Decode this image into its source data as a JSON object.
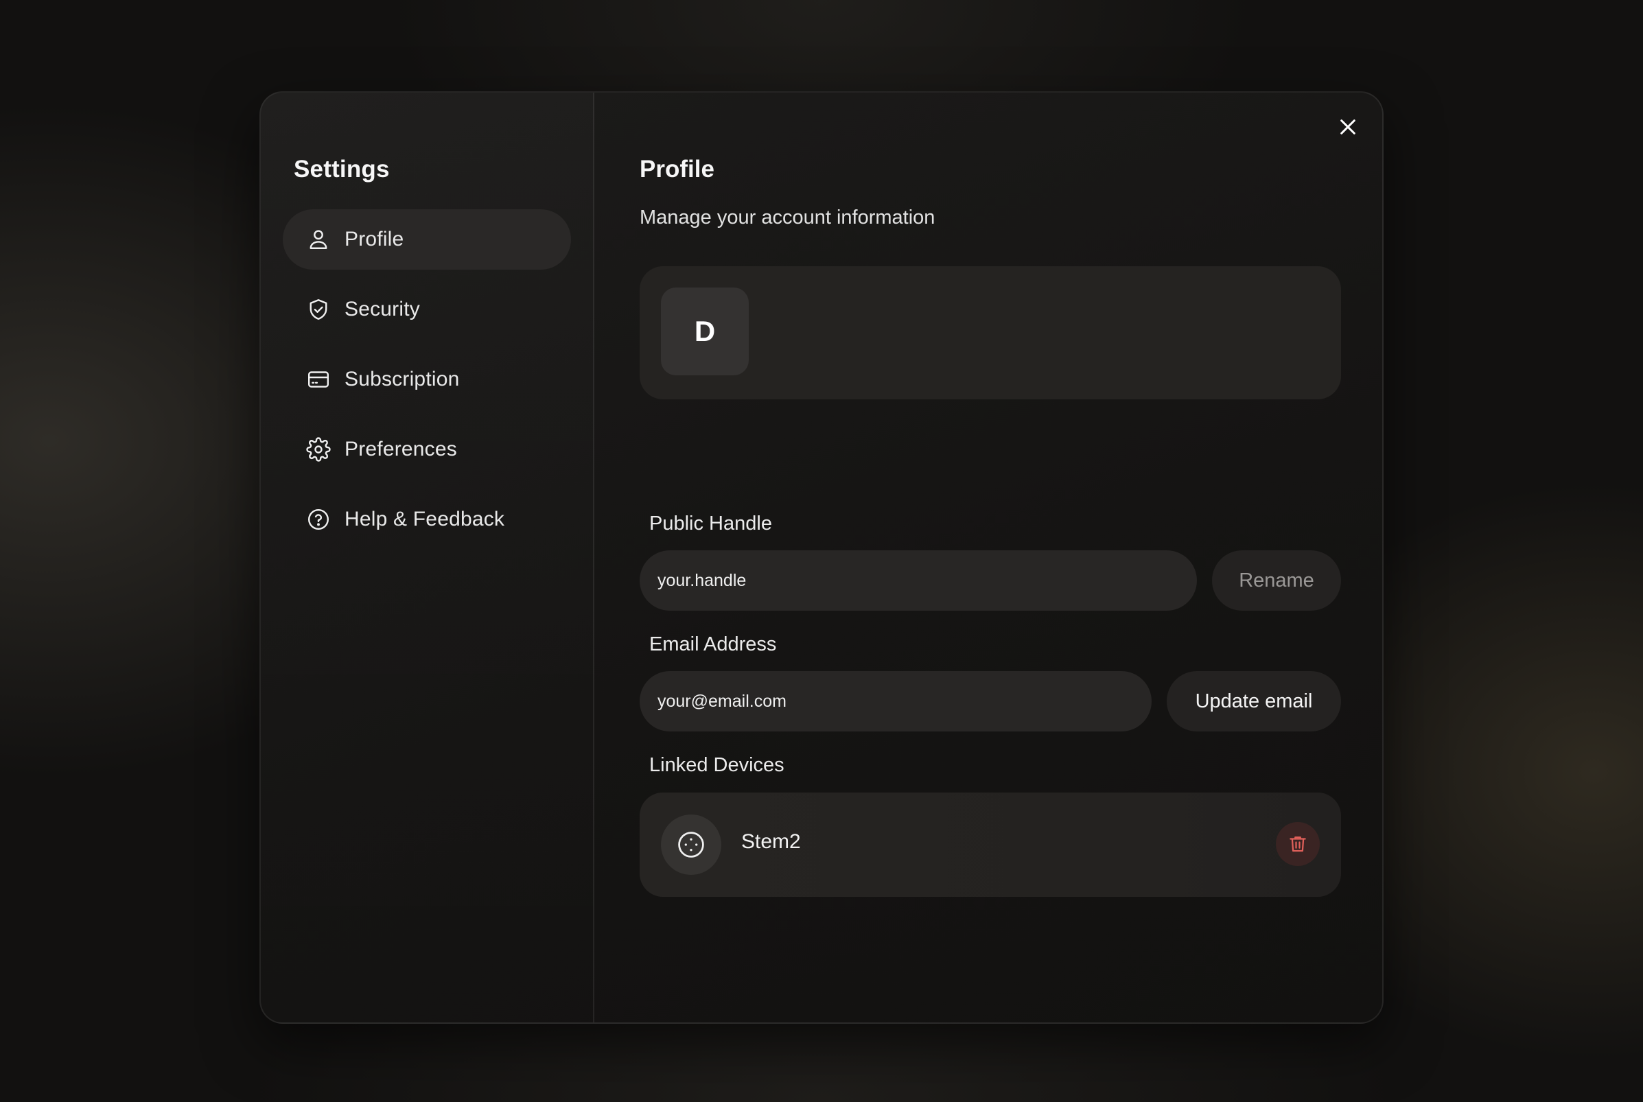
{
  "sidebar": {
    "title": "Settings",
    "items": [
      {
        "label": "Profile",
        "icon": "user-icon",
        "active": true
      },
      {
        "label": "Security",
        "icon": "shield-check-icon",
        "active": false
      },
      {
        "label": "Subscription",
        "icon": "credit-card-icon",
        "active": false
      },
      {
        "label": "Preferences",
        "icon": "gear-icon",
        "active": false
      },
      {
        "label": "Help & Feedback",
        "icon": "help-circle-icon",
        "active": false
      }
    ]
  },
  "main": {
    "title": "Profile",
    "subtitle": "Manage your account information",
    "avatar_initial": "D",
    "handle": {
      "label": "Public Handle",
      "placeholder": "your.handle",
      "value": "",
      "button_label": "Rename"
    },
    "email": {
      "label": "Email Address",
      "placeholder": "your@email.com",
      "value": "",
      "button_label": "Update email"
    },
    "devices": {
      "label": "Linked Devices",
      "items": [
        {
          "name": "Stem2",
          "icon": "device-icon"
        }
      ]
    }
  },
  "colors": {
    "accent_danger": "#e0605a",
    "active_nav_bg": "#2a2827",
    "modal_bg": "#181716"
  }
}
